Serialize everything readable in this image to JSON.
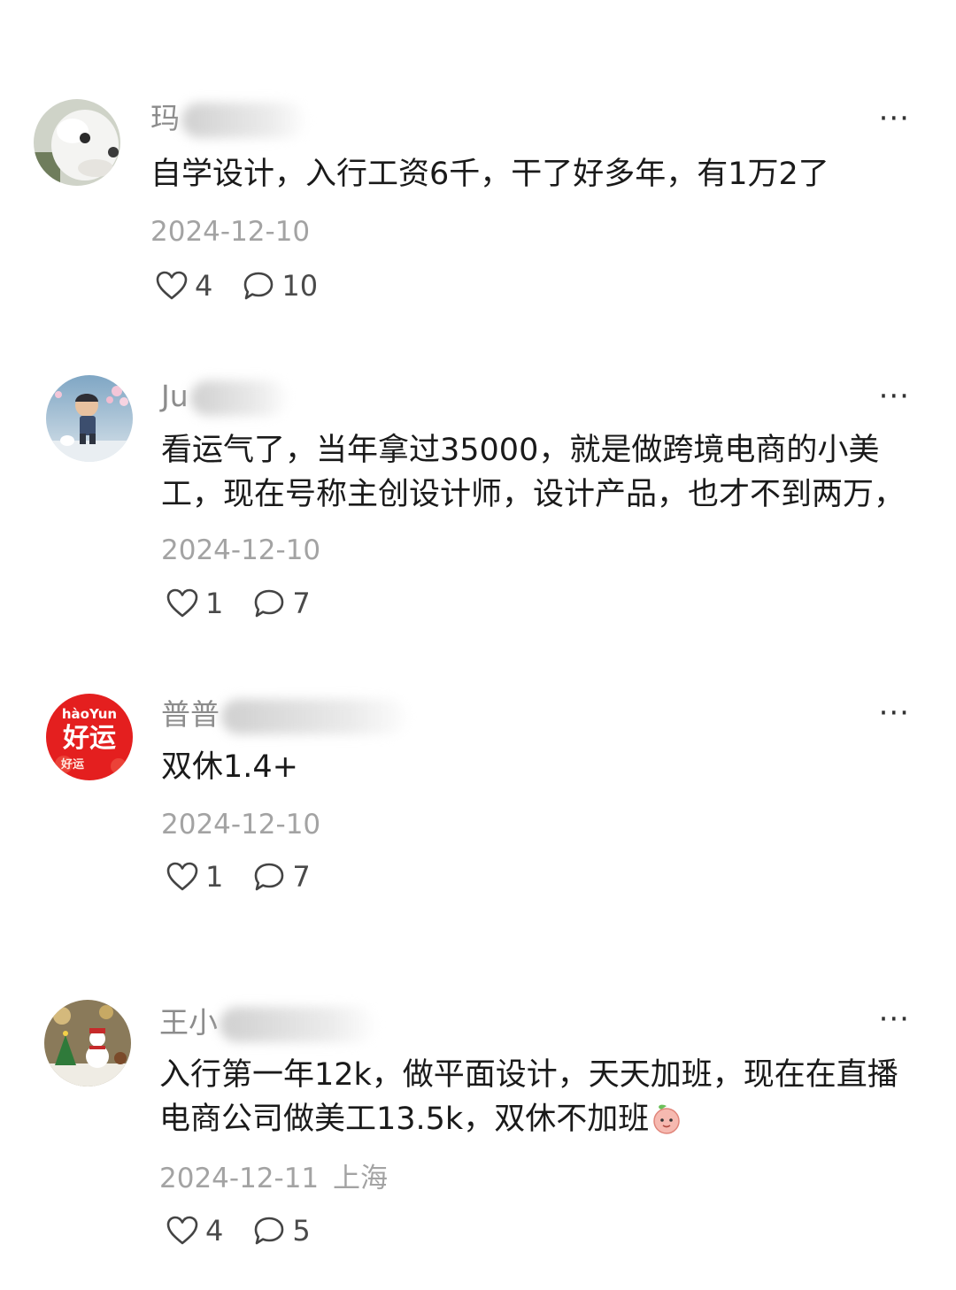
{
  "comments": [
    {
      "username_visible": "玛",
      "text_lines": [
        "自学设计，入行工资6千，干了好多年，有1万2了"
      ],
      "date": "2024-12-10",
      "location": "",
      "likes": "4",
      "replies": "10",
      "avatar_icon": "white-dog-avatar"
    },
    {
      "username_visible": "Ju",
      "text_lines": [
        "看运气了，当年拿过35000，就是做跨境电商的小美",
        "工，现在号称主创设计师，设计产品，也才不到两万，"
      ],
      "date": "2024-12-10",
      "location": "",
      "likes": "1",
      "replies": "7",
      "avatar_icon": "cartoon-boy-avatar"
    },
    {
      "username_visible": "普普",
      "text_lines": [
        "双休1.4+"
      ],
      "date": "2024-12-10",
      "location": "",
      "likes": "1",
      "replies": "7",
      "avatar_icon": "haoyun-good-luck-avatar",
      "avatar_text": {
        "pinyin": "hàoYun",
        "hanzi": "好运",
        "small": "好运"
      }
    },
    {
      "username_visible": "王小",
      "text_lines": [
        "入行第一年12k，做平面设计，天天加班，现在在直播",
        "电商公司做美工13.5k，双休不加班"
      ],
      "date": "2024-12-11",
      "location": "上海",
      "likes": "4",
      "replies": "5",
      "avatar_icon": "christmas-snowman-avatar",
      "inline_emoji": "peach-emoji"
    }
  ],
  "icons": {
    "like": "heart-outline-icon",
    "reply": "speech-bubble-icon",
    "more": "more-dots-icon"
  },
  "more_label": "···",
  "colors": {
    "username": "#8c8c8c",
    "body": "#1a1a1a",
    "date": "#a3a3a3",
    "action": "#4a4a4a",
    "avatar_red": "#e02020"
  }
}
